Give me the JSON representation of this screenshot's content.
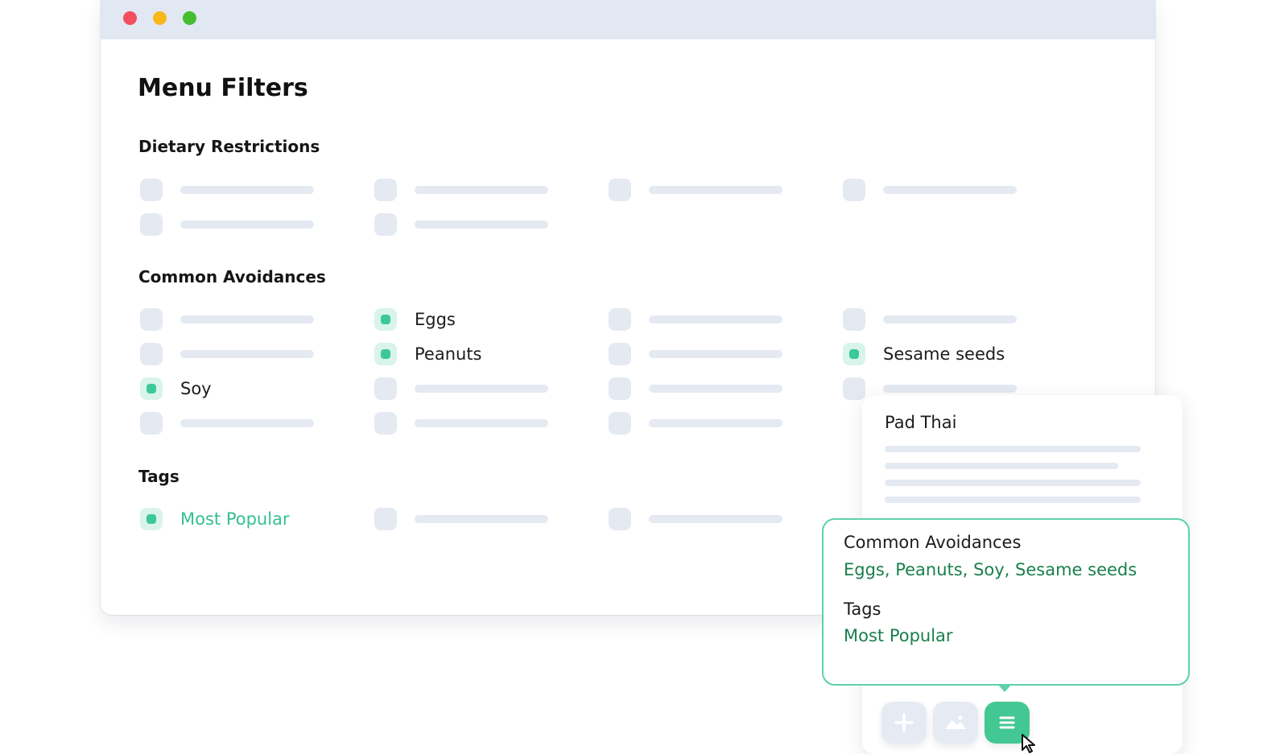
{
  "window": {
    "controls": [
      {
        "name": "close",
        "color": "#f24e5d"
      },
      {
        "name": "minimize",
        "color": "#f9b81a"
      },
      {
        "name": "zoom",
        "color": "#46bd2e"
      }
    ]
  },
  "page": {
    "title": "Menu Filters"
  },
  "sections": {
    "dietary": {
      "title": "Dietary Restrictions"
    },
    "avoidances": {
      "title": "Common Avoidances",
      "options": {
        "eggs": {
          "label": "Eggs",
          "checked": true
        },
        "peanuts": {
          "label": "Peanuts",
          "checked": true
        },
        "sesame": {
          "label": "Sesame seeds",
          "checked": true
        },
        "soy": {
          "label": "Soy",
          "checked": true
        }
      }
    },
    "tags": {
      "title": "Tags",
      "options": {
        "most_popular": {
          "label": "Most Popular",
          "checked": true
        }
      }
    }
  },
  "menu_item_card": {
    "title": "Pad Thai",
    "popover": {
      "avoidances_label": "Common Avoidances",
      "avoidances_value": "Eggs, Peanuts, Soy, Sesame seeds",
      "tags_label": "Tags",
      "tags_value": "Most Popular"
    },
    "toolbar": [
      {
        "icon": "plus-icon"
      },
      {
        "icon": "image-icon"
      },
      {
        "icon": "menu-lines-icon",
        "active": true
      }
    ]
  },
  "colors": {
    "accent": "#3cc897",
    "accent_dark": "#1a7f4b",
    "placeholder": "#e4e9f2",
    "titlebar": "#e2e8f2"
  }
}
